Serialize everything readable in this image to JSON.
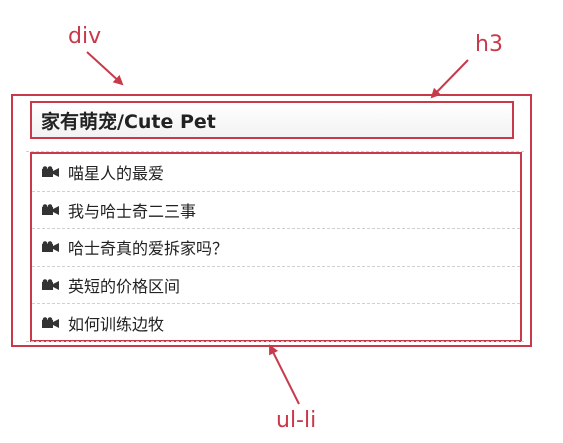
{
  "annotations": {
    "div_label": "div",
    "h3_label": "h3",
    "ul_label": "ul-li"
  },
  "heading": {
    "title": "家有萌宠/Cute Pet"
  },
  "list": {
    "icon": "camera-icon",
    "items": [
      {
        "label": "喵星人的最爱"
      },
      {
        "label": "我与哈士奇二三事"
      },
      {
        "label": "哈士奇真的爱拆家吗？"
      },
      {
        "label": "英短的价格区间"
      },
      {
        "label": "如何训练边牧"
      }
    ]
  },
  "colors": {
    "annotation": "#c8394a",
    "text": "#222222"
  }
}
